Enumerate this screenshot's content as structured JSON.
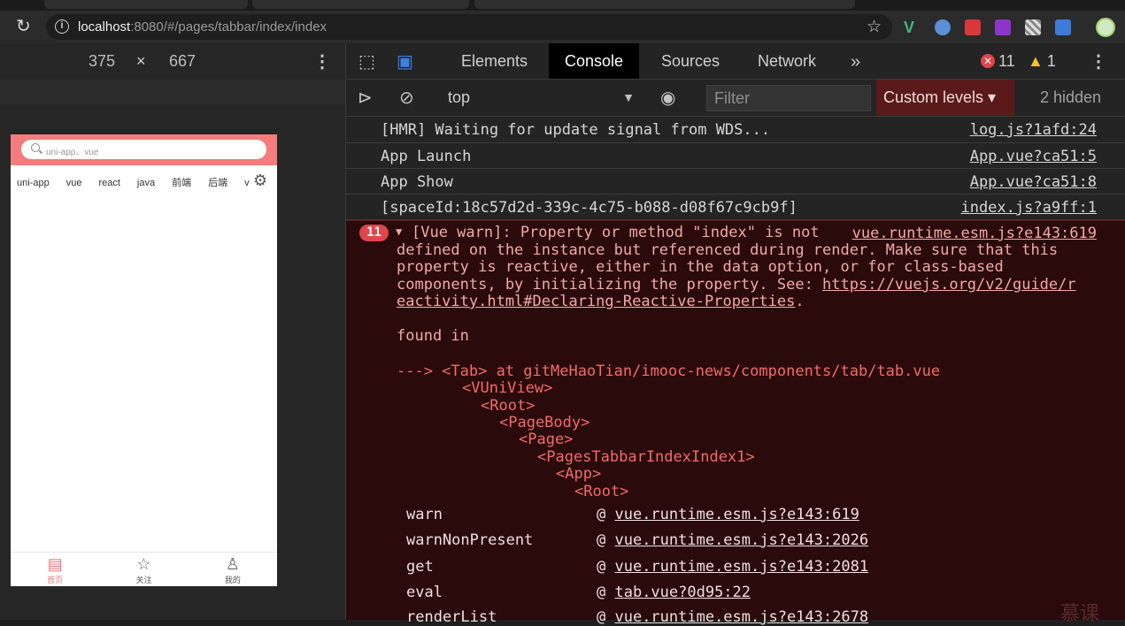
{
  "browser": {
    "url_host": "localhost",
    "url_rest": ":8080/#/pages/tabbar/index/index"
  },
  "device_toolbar": {
    "width": "375",
    "separator": "×",
    "height": "667"
  },
  "phone": {
    "search_placeholder": "uni-app、vue",
    "tabs": [
      "uni-app",
      "vue",
      "react",
      "java",
      "前端",
      "后端",
      "vue"
    ],
    "tabbar": [
      {
        "label": "首页",
        "icon": "document-icon",
        "active": true
      },
      {
        "label": "关注",
        "icon": "star-icon",
        "active": false
      },
      {
        "label": "我的",
        "icon": "user-icon",
        "active": false
      }
    ]
  },
  "devtools": {
    "tabs": [
      "Elements",
      "Console",
      "Sources",
      "Network"
    ],
    "active_tab": "Console",
    "error_count": "11",
    "warning_count": "1",
    "context": "top",
    "filter_placeholder": "Filter",
    "levels_label": "Custom levels",
    "hidden_label": "2 hidden"
  },
  "console": {
    "rows": [
      {
        "msg": "[HMR] Waiting for update signal from WDS...",
        "src": "log.js?1afd:24"
      },
      {
        "msg": "App Launch",
        "src": "App.vue?ca51:5"
      },
      {
        "msg": "App Show",
        "src": "App.vue?ca51:8"
      },
      {
        "msg": "[spaceId:18c57d2d-339c-4c75-b088-d08f67c9cb9f]",
        "src": "index.js?a9ff:1"
      }
    ],
    "error": {
      "count": "11",
      "src": "vue.runtime.esm.js?e143:619",
      "line1": "[Vue warn]: Property or method \"index\" is not",
      "line2": "defined on the instance but referenced during render. Make sure that this",
      "line3": "property is reactive, either in the data option, or for class-based",
      "line4a": "components, by initializing the property. See: ",
      "line4b": "https://vuejs.org/v2/guide/r",
      "line5a": "eactivity.html#Declaring-Reactive-Properties",
      "line5b": ".",
      "found_in": "found in",
      "tree": [
        "---> <Tab> at gitMeHaoTian/imooc-news/components/tab/tab.vue",
        "<VUniView>",
        "<Root>",
        "<PageBody>",
        "<Page>",
        "<PagesTabbarIndexIndex1>",
        "<App>",
        "<Root>"
      ],
      "stack": [
        {
          "fn": "warn",
          "src": "vue.runtime.esm.js?e143:619"
        },
        {
          "fn": "warnNonPresent",
          "src": "vue.runtime.esm.js?e143:2026"
        },
        {
          "fn": "get",
          "src": "vue.runtime.esm.js?e143:2081"
        },
        {
          "fn": "eval",
          "src": "tab.vue?0d95:22"
        },
        {
          "fn": "renderList",
          "src": "vue.runtime.esm.js?e143:2678"
        }
      ]
    }
  },
  "watermark": "慕课"
}
